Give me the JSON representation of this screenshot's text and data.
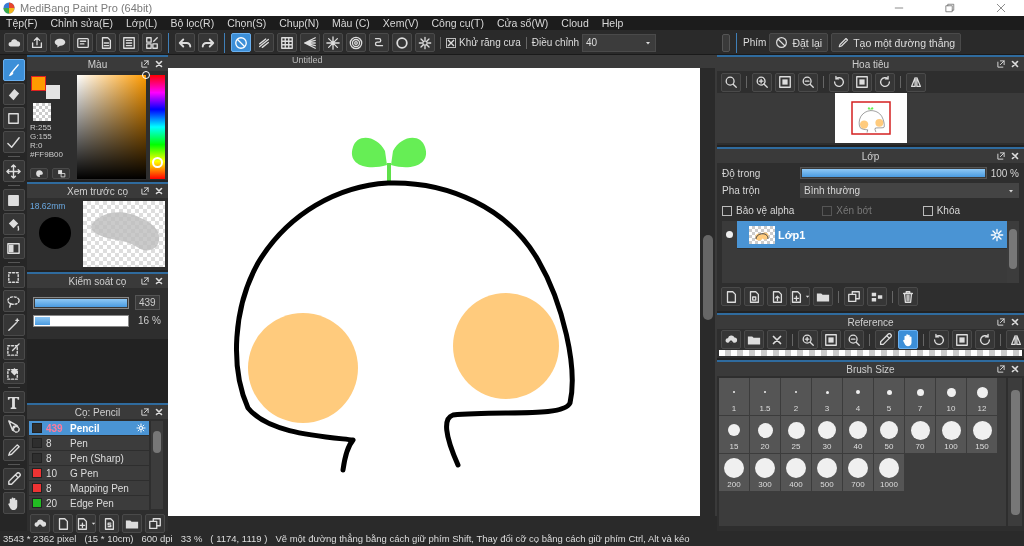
{
  "window": {
    "title": "MediBang Paint Pro (64bit)"
  },
  "menu": [
    "Tệp(F)",
    "Chỉnh sửa(E)",
    "Lớp(L)",
    "Bộ lọc(R)",
    "Chọn(S)",
    "Chụp(N)",
    "Màu (C)",
    "Xem(V)",
    "Công cụ(T)",
    "Cửa sổ(W)",
    "Cloud",
    "Help"
  ],
  "toolbar": {
    "snap_modes": [
      {
        "selected": true
      },
      {
        "selected": false
      },
      {
        "selected": false
      },
      {
        "selected": false
      },
      {
        "selected": false
      },
      {
        "selected": false
      },
      {
        "selected": false
      },
      {
        "selected": false
      },
      {
        "selected": false
      }
    ],
    "antialias": {
      "label": "Khử răng cưa",
      "checked": true
    },
    "correction": {
      "label": "Điều chỉnh",
      "value": "40"
    },
    "key_label": "Phím",
    "buttons": [
      "Đặt lại",
      "Tạo một đường thẳng"
    ]
  },
  "tools": [
    {
      "selected": true
    },
    {
      "selected": false
    },
    {
      "selected": false
    },
    {
      "selected": false
    },
    {
      "selected": false
    },
    {
      "selected": false
    },
    {
      "selected": false
    },
    {
      "selected": false
    },
    {
      "selected": false
    },
    {
      "selected": false
    },
    {
      "selected": false
    },
    {
      "selected": false
    },
    {
      "selected": false
    },
    {
      "selected": false
    },
    {
      "selected": false
    },
    {
      "selected": false
    },
    {
      "selected": false
    },
    {
      "selected": false
    }
  ],
  "color_panel": {
    "title": "Màu",
    "swatches": [
      {
        "kind": "foreground",
        "color": "#ff9b00"
      },
      {
        "kind": "background",
        "color": "#e4e4e4"
      },
      {
        "kind": "transparent"
      }
    ],
    "readout": [
      "R:255",
      "G:155",
      "R:0",
      "#FF9B00"
    ],
    "hue": {
      "level": 0.1
    }
  },
  "brush_preview": {
    "title": "Xem trước cọ",
    "size": "18.62mm"
  },
  "brush_control": {
    "title": "Kiểm soát cọ",
    "size": {
      "level": 1,
      "reading": "439"
    },
    "opacity": {
      "level": 0.16,
      "reading": "16 %"
    }
  },
  "brush_list": {
    "title": "Cọ: Pencil",
    "items": [
      {
        "color": "#2e2e2e",
        "size": "439",
        "name": "Pencil",
        "selected": true
      },
      {
        "color": "#2e2e2e",
        "size": "8",
        "name": "Pen",
        "selected": false
      },
      {
        "color": "#2e2e2e",
        "size": "8",
        "name": "Pen (Sharp)",
        "selected": false
      },
      {
        "color": "#ee3333",
        "size": "10",
        "name": "G Pen",
        "selected": false
      },
      {
        "color": "#ee3333",
        "size": "8",
        "name": "Mapping Pen",
        "selected": false
      },
      {
        "color": "#22bb22",
        "size": "20",
        "name": "Edge Pen",
        "selected": false
      }
    ]
  },
  "canvas": {
    "tab": "Untitled"
  },
  "navigator": {
    "title": "Hoa tiêu"
  },
  "layers": {
    "title": "Lớp",
    "opacity": {
      "label": "Độ trong",
      "level": 1,
      "reading": "100 %"
    },
    "blend": {
      "label": "Pha trộn",
      "value": "Bình thường"
    },
    "options": [
      {
        "label": "Bảo vệ alpha",
        "checked": false,
        "disabled": false
      },
      {
        "label": "Xén bớt",
        "checked": false,
        "disabled": true
      },
      {
        "label": "Khóa",
        "checked": false,
        "disabled": false
      }
    ],
    "items": [
      {
        "name": "Lớp1",
        "selected": true,
        "visible": true
      }
    ]
  },
  "reference": {
    "title": "Reference",
    "tools": [
      {
        "selected": false
      },
      {
        "selected": false
      },
      {
        "selected": false
      },
      {
        "selected": false
      },
      {
        "selected": false
      },
      {
        "selected": false
      },
      {
        "selected": false
      },
      {
        "selected": true
      },
      {
        "selected": false
      },
      {
        "selected": false
      },
      {
        "selected": false
      },
      {
        "selected": false
      }
    ]
  },
  "brush_sizes": {
    "title": "Brush Size",
    "sizes": [
      "1",
      "1.5",
      "2",
      "3",
      "4",
      "5",
      "7",
      "10",
      "12",
      "15",
      "20",
      "25",
      "30",
      "40",
      "50",
      "70",
      "100",
      "150",
      "200",
      "300",
      "400",
      "500",
      "700",
      "1000"
    ]
  },
  "status_bar": {
    "items": [
      "3543 * 2362 pixel",
      "(15 * 10cm)",
      "600 dpi",
      "33 %",
      "( 1174, 1119 )"
    ],
    "hint": "Vẽ một đường thẳng bằng cách giữ phím Shift, Thay đổi cỡ cọ bằng cách giữ phím Ctrl, Alt và kéo"
  }
}
